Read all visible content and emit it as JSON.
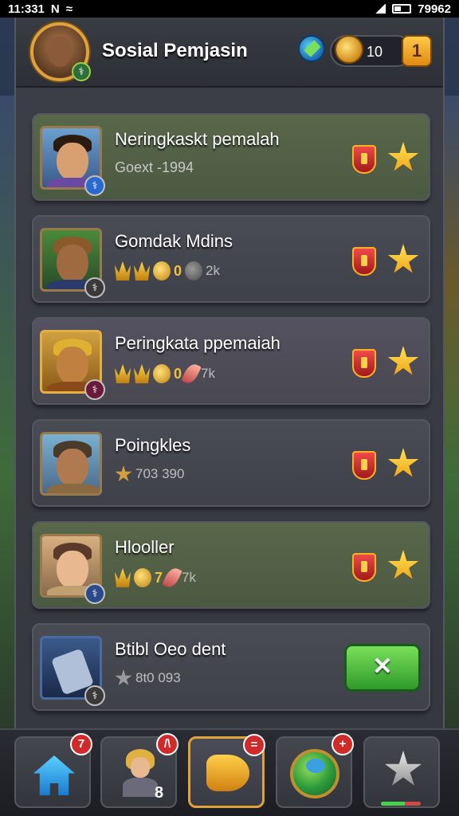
{
  "status_bar": {
    "time": "11:331",
    "right_text": "79962"
  },
  "header": {
    "title": "Sosial Pemjasin",
    "coins": "10",
    "plus_label": "1",
    "avatar_badge": "⚕"
  },
  "rows": [
    {
      "name": "Neringkaskt pemalah",
      "sub": "Goext -1994",
      "badge": "⚕"
    },
    {
      "name": "Gomdak Mdins",
      "stat_a": "0",
      "stat_b": "2k",
      "badge": "⚕"
    },
    {
      "name": "Peringkata ppemaiah",
      "stat_a": "0",
      "stat_b": "7k",
      "badge": "⚕"
    },
    {
      "name": "Poingkles",
      "stat_text": "703 390"
    },
    {
      "name": "Hlooller",
      "stat_a": "7",
      "stat_b": "7k",
      "badge": "⚕"
    },
    {
      "name": "Btibl Oeo dent",
      "stat_text": "8t0 093",
      "button_label": "✕",
      "badge": "⚕"
    }
  ],
  "nav": {
    "home_badge": "7",
    "friends_badge": "/\\",
    "friends_count": "8",
    "shop_badge": "=",
    "world_badge": "+"
  },
  "colors": {
    "accent_gold": "#e0a23a",
    "row_green": "#58674a",
    "button_green": "#2e9a2a",
    "badge_red": "#d02a2a"
  },
  "icons": [
    "home-icon",
    "character-icon",
    "fish-icon",
    "globe-icon",
    "star-icon",
    "gem-icon",
    "coin-icon"
  ]
}
